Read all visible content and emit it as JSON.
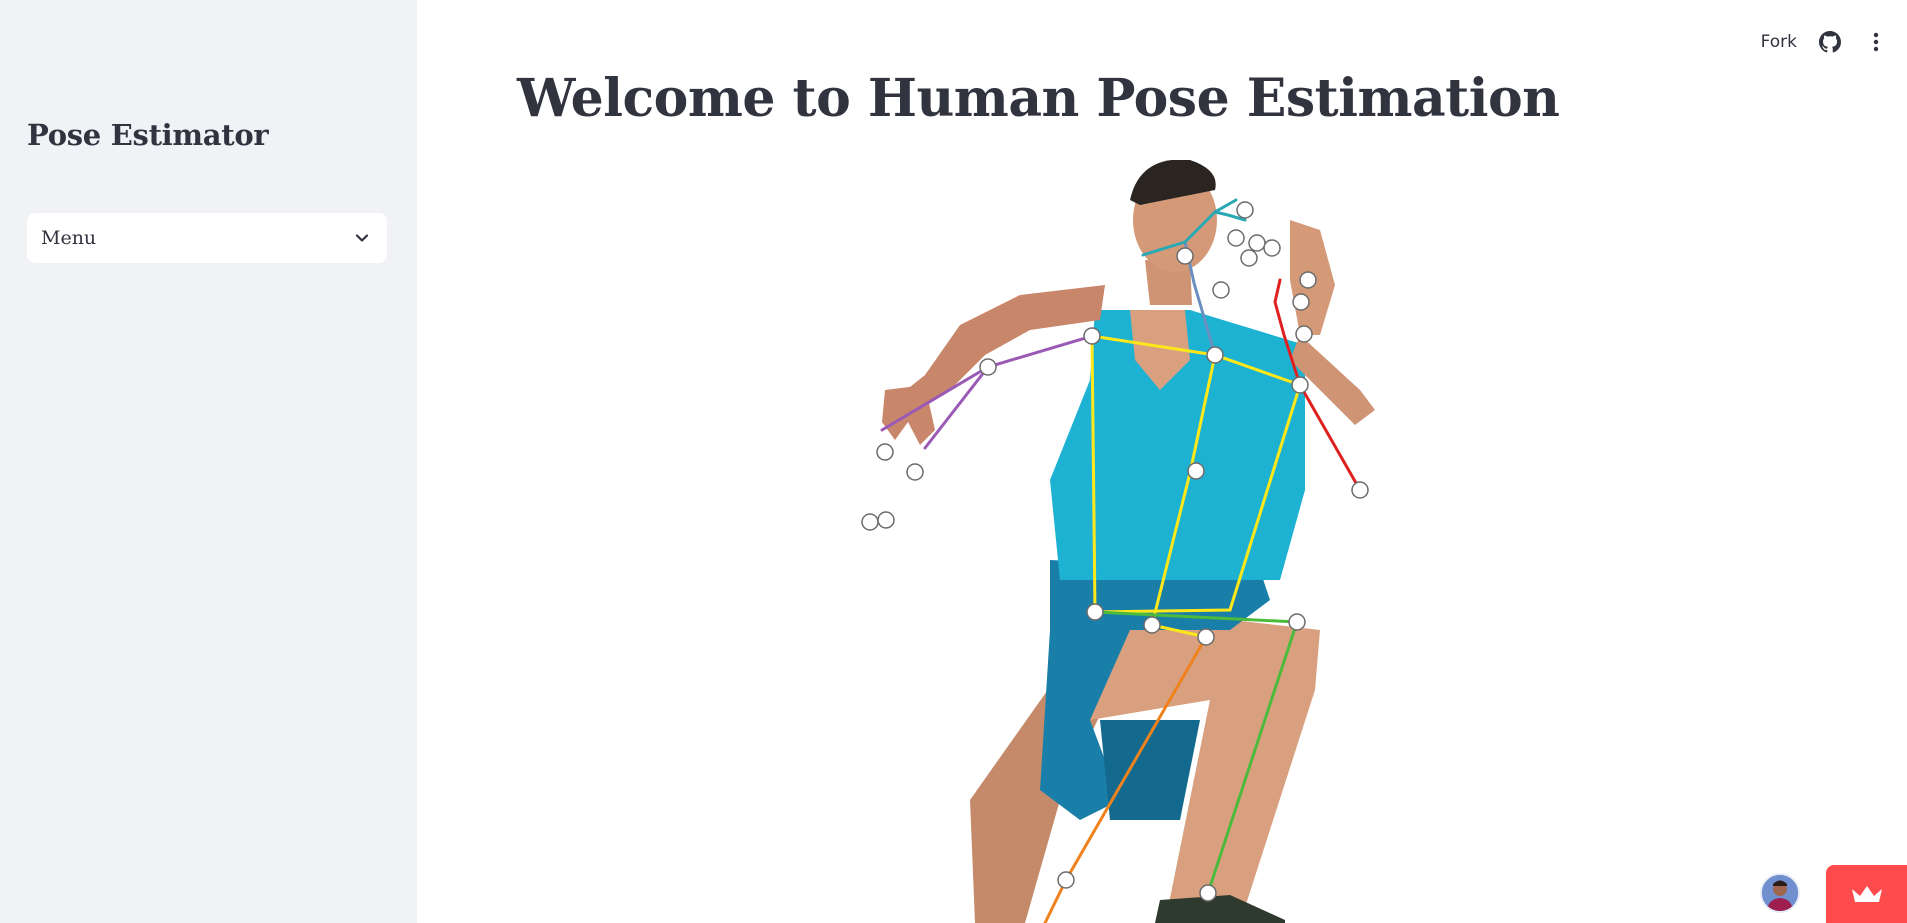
{
  "sidebar": {
    "app_title": "Pose Estimator",
    "menu": {
      "selected": "Menu"
    }
  },
  "toolbar": {
    "fork_label": "Fork",
    "github_icon": "github-icon",
    "more_icon": "vertical-ellipsis-icon"
  },
  "main": {
    "title": "Welcome to Human Pose Estimation",
    "image_subject": "athlete-with-pose-keypoints"
  },
  "footer": {
    "avatar_icon": "user-avatar",
    "badge_icon": "crown-icon"
  },
  "colors": {
    "sidebar_bg": "#f0f2f6",
    "text": "#31333f",
    "accent": "#ff4b4b",
    "skeleton_torso": "#ffe81a",
    "skeleton_left_leg": "#4cbb3c",
    "skeleton_right_leg": "#f0821e",
    "skeleton_left_arm": "#e02020",
    "skeleton_right_arm": "#9b59b6",
    "skeleton_head": "#27a9b4"
  }
}
